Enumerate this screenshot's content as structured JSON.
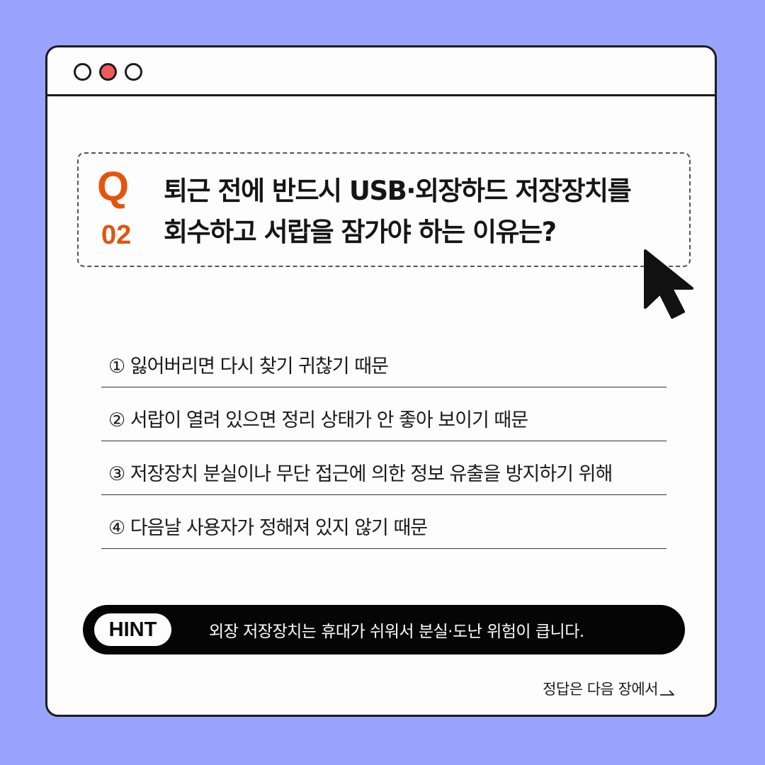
{
  "window": {
    "controls": [
      "window-control-circle",
      "window-control-circle-red",
      "window-control-circle"
    ]
  },
  "question": {
    "mark": "Q",
    "number": "02",
    "line1": "퇴근 전에 반드시 USB·외장하드 저장장치를",
    "line2": "회수하고 서랍을 잠가야 하는 이유는?",
    "accent_color": "#e4540d"
  },
  "options": [
    {
      "label": "① 잃어버리면 다시 찾기 귀찮기 때문"
    },
    {
      "label": "② 서랍이 열려 있으면 정리 상태가 안 좋아 보이기 때문"
    },
    {
      "label": "③ 저장장치 분실이나 무단 접근에 의한 정보 유출을 방지하기 위해"
    },
    {
      "label": "④ 다음날 사용자가 정해져 있지 않기 때문"
    }
  ],
  "hint": {
    "badge": "HINT",
    "text": "외장 저장장치는 휴대가 쉬워서 분실·도난 위험이 큽니다."
  },
  "footer": {
    "next_label": "정답은 다음 장에서"
  },
  "colors": {
    "background": "#98a4fe",
    "window": "#fdfdfd",
    "red_dot": "#f05a5a"
  },
  "icons": [
    "cursor-arrow-icon",
    "arrow-right-icon"
  ]
}
